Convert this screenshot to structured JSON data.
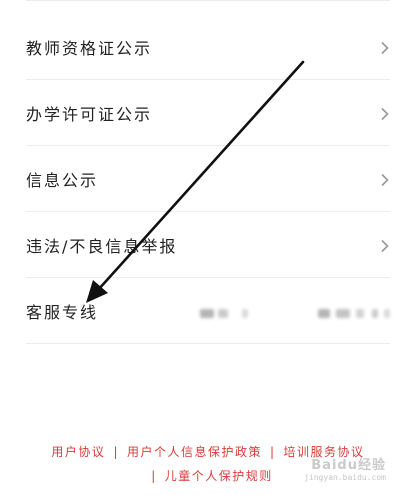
{
  "menu": {
    "items": [
      {
        "label": "教师资格证公示"
      },
      {
        "label": "办学许可证公示"
      },
      {
        "label": "信息公示"
      },
      {
        "label": "违法/不良信息举报"
      },
      {
        "label": "客服专线"
      }
    ]
  },
  "footer": {
    "links": [
      "用户协议",
      "用户个人信息保护政策",
      "培训服务协议",
      "儿童个人保护规则"
    ],
    "separator": "|"
  },
  "watermark": {
    "brand": "Baidu经验",
    "url": "jingyan.baidu.com"
  },
  "colors": {
    "footer_link": "#d93b3b",
    "divider": "#ececec",
    "label": "#222222",
    "chevron": "#9a9a9a",
    "annotation_arrow": "#111111"
  },
  "icons": [
    "chevron-right-icon",
    "annotation-arrow-icon"
  ]
}
